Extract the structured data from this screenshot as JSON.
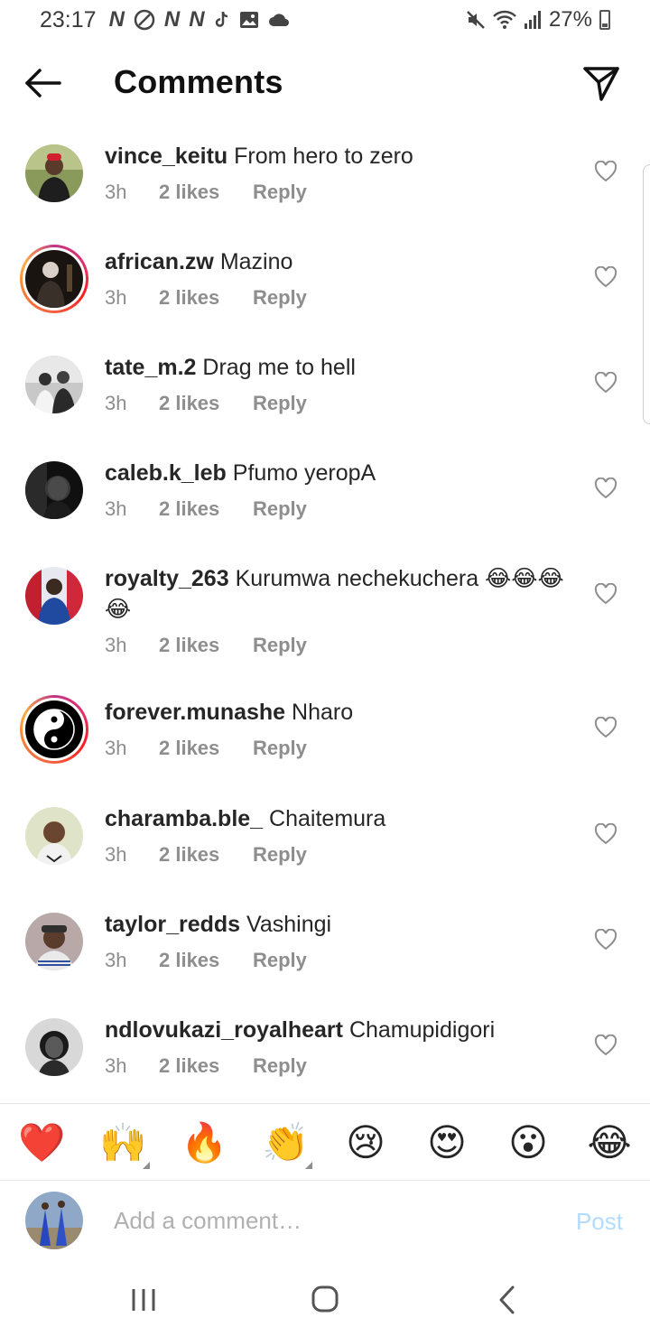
{
  "status_bar": {
    "time": "23:17",
    "notif_letter": "N",
    "battery": "27%"
  },
  "header": {
    "title": "Comments"
  },
  "comments": [
    {
      "user": "vince_keitu",
      "text": "From hero to zero",
      "time": "3h",
      "likes": "2 likes",
      "reply": "Reply"
    },
    {
      "user": "african.zw",
      "text": "Mazino",
      "time": "3h",
      "likes": "2 likes",
      "reply": "Reply"
    },
    {
      "user": "tate_m.2",
      "text": "Drag me to hell",
      "time": "3h",
      "likes": "2 likes",
      "reply": "Reply"
    },
    {
      "user": "caleb.k_leb",
      "text": "Pfumo yeropA",
      "time": "3h",
      "likes": "2 likes",
      "reply": "Reply"
    },
    {
      "user": "royalty_263",
      "text": "Kurumwa nechekuchera 😂😂😂😂",
      "time": "3h",
      "likes": "2 likes",
      "reply": "Reply"
    },
    {
      "user": "forever.munashe",
      "text": "Nharo",
      "time": "3h",
      "likes": "2 likes",
      "reply": "Reply"
    },
    {
      "user": "charamba.ble_",
      "text": "Chaitemura",
      "time": "3h",
      "likes": "2 likes",
      "reply": "Reply"
    },
    {
      "user": "taylor_redds",
      "text": "Vashingi",
      "time": "3h",
      "likes": "2 likes",
      "reply": "Reply"
    },
    {
      "user": "ndlovukazi_royalheart",
      "text": "Chamupidigori",
      "time": "3h",
      "likes": "2 likes",
      "reply": "Reply"
    }
  ],
  "emoji_bar": [
    "❤️",
    "🙌",
    "🔥",
    "👏",
    "😢",
    "😍",
    "😮",
    "😂"
  ],
  "composer": {
    "placeholder": "Add a comment…",
    "post_label": "Post"
  },
  "colors": {
    "accent_disabled": "#b3dbff",
    "meta_gray": "#8e8e8e",
    "text": "#262626"
  }
}
